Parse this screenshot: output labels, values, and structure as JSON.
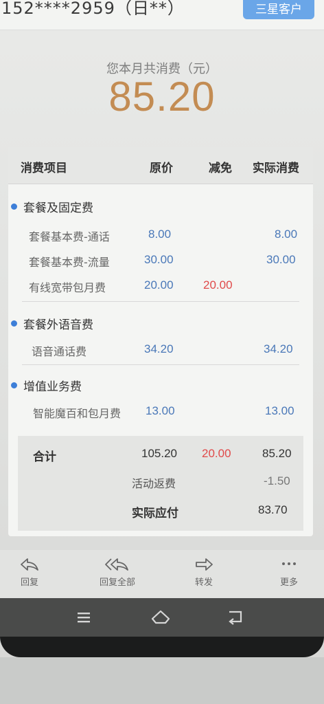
{
  "header": {
    "phone_number": "152****2959（日**）",
    "badge": "三星客户"
  },
  "summary": {
    "label": "您本月共消费（元）",
    "amount": "85.20"
  },
  "table": {
    "headers": [
      "消费项目",
      "原价",
      "减免",
      "实际消费"
    ],
    "sections": [
      {
        "title": "套餐及固定费",
        "rows": [
          {
            "name": "套餐基本费-通话",
            "original": "8.00",
            "discount": "",
            "actual": "8.00"
          },
          {
            "name": "套餐基本费-流量",
            "original": "30.00",
            "discount": "",
            "actual": "30.00"
          },
          {
            "name": "有线宽带包月费",
            "original": "20.00",
            "discount": "20.00",
            "actual": ""
          }
        ]
      },
      {
        "title": "套餐外语音费",
        "rows": [
          {
            "name": "语音通话费",
            "original": "34.20",
            "discount": "",
            "actual": "34.20"
          }
        ]
      },
      {
        "title": "增值业务费",
        "rows": [
          {
            "name": "智能魔百和包月费",
            "original": "13.00",
            "discount": "",
            "actual": "13.00"
          }
        ]
      }
    ],
    "total": {
      "label": "合计",
      "original": "105.20",
      "discount": "20.00",
      "actual": "85.20"
    },
    "rebate": {
      "label": "活动返费",
      "value": "-1.50"
    },
    "payable": {
      "label": "实际应付",
      "value": "83.70"
    }
  },
  "actions": [
    {
      "label": "回复",
      "icon": "reply-icon"
    },
    {
      "label": "回复全部",
      "icon": "reply-all-icon"
    },
    {
      "label": "转发",
      "icon": "forward-icon"
    },
    {
      "label": "更多",
      "icon": "more-icon"
    }
  ],
  "nav": [
    {
      "icon": "recent-apps-icon"
    },
    {
      "icon": "home-icon"
    },
    {
      "icon": "back-icon"
    }
  ],
  "colors": {
    "accent_blue": "#3d7fd8",
    "amount_gold": "#c38c53",
    "discount_red": "#e04a4a",
    "badge_blue": "#6aa6e8"
  }
}
